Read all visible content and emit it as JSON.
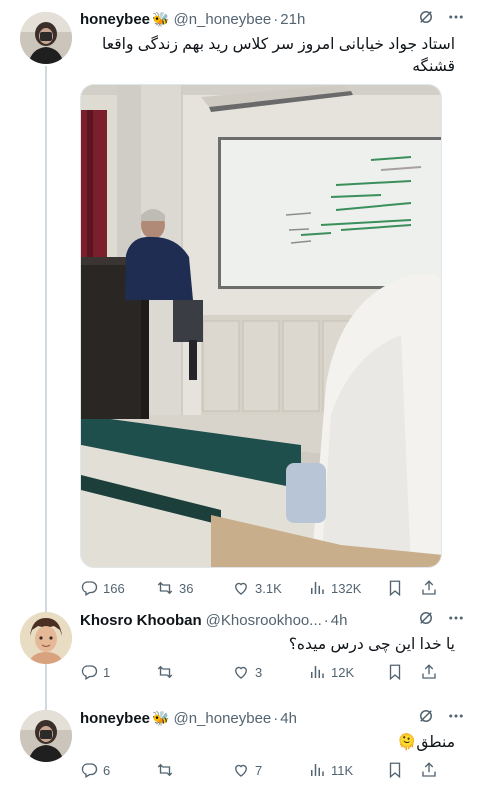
{
  "tweets": [
    {
      "name": "honeybee",
      "emoji": "🐝",
      "handle": "@n_honeybee",
      "time": "21h",
      "text": "استاد جواد خیابانی امروز سر کلاس رید بهم زندگی واقعا قشنگه",
      "stats": {
        "replies": "166",
        "retweets": "36",
        "likes": "3.1K",
        "views": "132K"
      }
    },
    {
      "name": "Khosro Khooban",
      "handle": "@Khosrookhoo...",
      "time": "4h",
      "text": "یا خدا این چی درس میده؟",
      "stats": {
        "replies": "1",
        "retweets": "",
        "likes": "3",
        "views": "12K"
      }
    },
    {
      "name": "honeybee",
      "emoji": "🐝",
      "handle": "@n_honeybee",
      "time": "4h",
      "text": "منطق🫠",
      "stats": {
        "replies": "6",
        "retweets": "",
        "likes": "7",
        "views": "11K"
      }
    }
  ],
  "icons": [
    "grok-icon",
    "more-icon",
    "reply-icon",
    "retweet-icon",
    "like-icon",
    "views-icon",
    "bookmark-icon",
    "share-icon"
  ],
  "colors": {
    "text": "#0f1419",
    "muted": "#536471",
    "line": "#cfd9de"
  }
}
